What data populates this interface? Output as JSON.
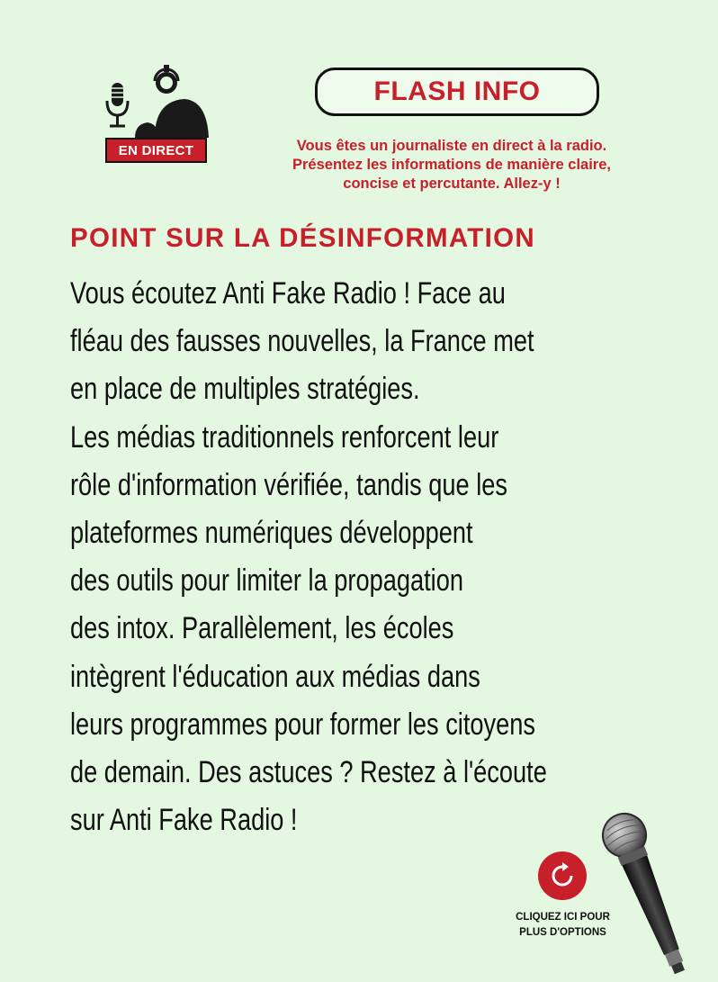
{
  "header": {
    "live_badge": "EN DIRECT",
    "flash_label": "FLASH INFO",
    "instruction": [
      "Vous êtes un journaliste en direct à la radio.",
      "Présentez les informations de manière claire,",
      "concise et percutante. Allez-y !"
    ]
  },
  "section_title": "POINT SUR LA DÉSINFORMATION",
  "body_lines": [
    "Vous écoutez Anti Fake Radio ! Face au",
    "fléau des fausses nouvelles, la France met",
    "en place de multiples stratégies.",
    "Les médias traditionnels renforcent leur",
    "rôle d'information vérifiée, tandis que les",
    "plateformes numériques développent",
    "des outils pour limiter la propagation",
    "des intox. Parallèlement, les écoles",
    "intègrent l'éducation aux médias dans",
    "leurs programmes pour former les citoyens",
    "de demain. Des astuces ? Restez à l'écoute",
    "sur Anti Fake Radio !"
  ],
  "options": {
    "label_line1": "CLIQUEZ ICI POUR",
    "label_line2": "PLUS D'OPTIONS"
  },
  "colors": {
    "background": "#e3f7e1",
    "accent_red": "#c8202a",
    "text_dark": "#111111"
  },
  "icons": [
    "presenter-microphone-icon",
    "refresh-icon",
    "handheld-microphone-icon"
  ]
}
